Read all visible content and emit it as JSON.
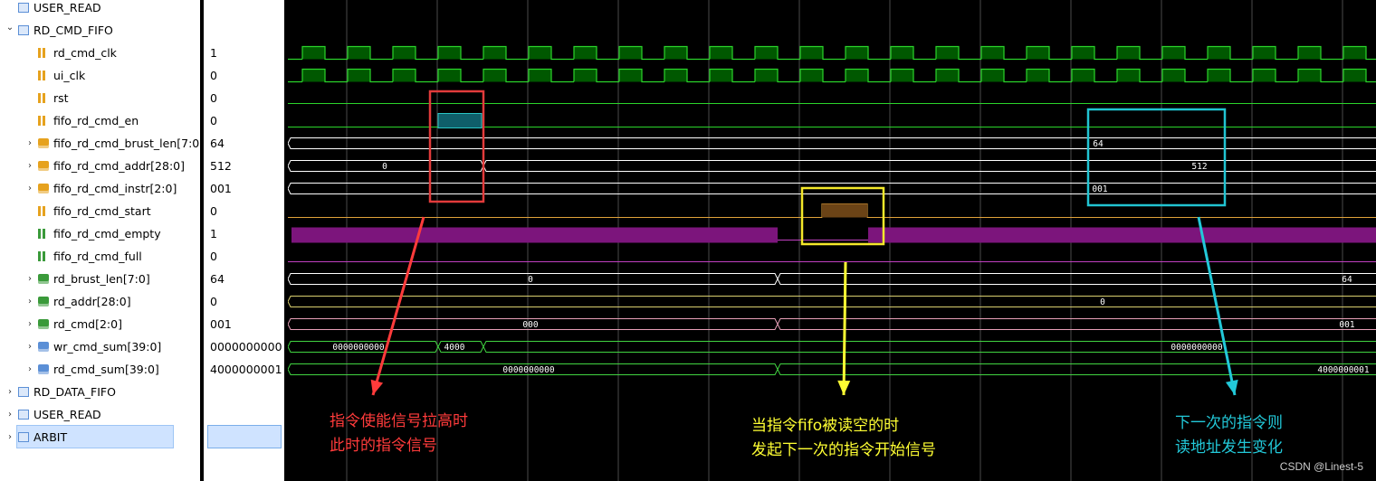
{
  "tree": [
    {
      "label": "USER_READ",
      "indent": 0,
      "icon": "group",
      "expander": "none",
      "value": ""
    },
    {
      "label": "RD_CMD_FIFO",
      "indent": 0,
      "icon": "group",
      "expander": "open",
      "value": ""
    },
    {
      "label": "rd_cmd_clk",
      "indent": 1,
      "icon": "bit-in",
      "expander": "none",
      "value": "1"
    },
    {
      "label": "ui_clk",
      "indent": 1,
      "icon": "bit-in",
      "expander": "none",
      "value": "0"
    },
    {
      "label": "rst",
      "indent": 1,
      "icon": "bit-in",
      "expander": "none",
      "value": "0"
    },
    {
      "label": "fifo_rd_cmd_en",
      "indent": 1,
      "icon": "bit-in",
      "expander": "none",
      "value": "0"
    },
    {
      "label": "fifo_rd_cmd_brust_len[7:0]",
      "indent": 1,
      "icon": "bus-in",
      "expander": "closed",
      "value": "64"
    },
    {
      "label": "fifo_rd_cmd_addr[28:0]",
      "indent": 1,
      "icon": "bus-in",
      "expander": "closed",
      "value": "512"
    },
    {
      "label": "fifo_rd_cmd_instr[2:0]",
      "indent": 1,
      "icon": "bus-in",
      "expander": "closed",
      "value": "001"
    },
    {
      "label": "fifo_rd_cmd_start",
      "indent": 1,
      "icon": "bit-in",
      "expander": "none",
      "value": "0"
    },
    {
      "label": "fifo_rd_cmd_empty",
      "indent": 1,
      "icon": "bit-out",
      "expander": "none",
      "value": "1"
    },
    {
      "label": "fifo_rd_cmd_full",
      "indent": 1,
      "icon": "bit-out",
      "expander": "none",
      "value": "0"
    },
    {
      "label": "rd_brust_len[7:0]",
      "indent": 1,
      "icon": "bus-out",
      "expander": "closed",
      "value": "64"
    },
    {
      "label": "rd_addr[28:0]",
      "indent": 1,
      "icon": "bus-out",
      "expander": "closed",
      "value": "0"
    },
    {
      "label": "rd_cmd[2:0]",
      "indent": 1,
      "icon": "bus-out",
      "expander": "closed",
      "value": "001"
    },
    {
      "label": "wr_cmd_sum[39:0]",
      "indent": 1,
      "icon": "bus-int",
      "expander": "closed",
      "value": "0000000000"
    },
    {
      "label": "rd_cmd_sum[39:0]",
      "indent": 1,
      "icon": "bus-int",
      "expander": "closed",
      "value": "4000000001"
    },
    {
      "label": "RD_DATA_FIFO",
      "indent": 0,
      "icon": "group",
      "expander": "closed",
      "value": ""
    },
    {
      "label": "USER_READ",
      "indent": 0,
      "icon": "group",
      "expander": "closed",
      "value": ""
    },
    {
      "label": "ARBIT",
      "indent": 0,
      "icon": "group",
      "expander": "closed",
      "value": "",
      "selected": true
    }
  ],
  "wave_labels": {
    "addr_a": "0",
    "len_right": "64",
    "addr_right": "512",
    "instr_right": "001",
    "rbl_mid": "0",
    "rbl_right": "64",
    "raddr_mid": "0",
    "rcmd_mid": "000",
    "rcmd_right": "001",
    "wsum_a": "0000000000",
    "wsum_b": "4000",
    "wsum_c": "0000000000",
    "rsum_a": "0000000000",
    "rsum_b": "4000000001"
  },
  "annotations": {
    "red": {
      "line1": "指令使能信号拉高时",
      "line2": "此时的指令信号",
      "color": "#ff3b3b"
    },
    "yellow": {
      "line1": "当指令fifo被读空的时",
      "line2": "发起下一次的指令开始信号",
      "color": "#ffff33"
    },
    "cyan": {
      "line1": "下一次的指令则",
      "line2": "读地址发生变化",
      "color": "#22c8d8"
    }
  },
  "colors": {
    "clk": "#00a000",
    "bus_white": "#ffffff",
    "bus_yellow": "#d9cf6e",
    "bus_pink": "#e8a0b8",
    "bus_green": "#41d441",
    "empty": "#7c157c",
    "en_fill": "#0f5e6a",
    "start_fill": "#6b4316"
  },
  "watermark": "CSDN @Linest-5"
}
